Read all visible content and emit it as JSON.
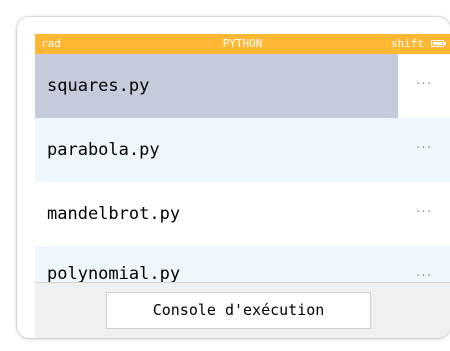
{
  "status_bar": {
    "left": "rad",
    "center": "PYTHON",
    "right": "shift",
    "battery_icon": "battery-icon",
    "battery_level": 1.0,
    "color": "#ffb734"
  },
  "scripts": [
    {
      "name": "squares.py",
      "menu": "···",
      "selected": true
    },
    {
      "name": "parabola.py",
      "menu": "···",
      "selected": false
    },
    {
      "name": "mandelbrot.py",
      "menu": "···",
      "selected": false
    },
    {
      "name": "polynomial.py",
      "menu": "···",
      "selected": false
    }
  ],
  "console_button": "Console d'exécution",
  "colors": {
    "selected_row": "#c6cbdc",
    "alt_row": "#eef6fe",
    "status_bar": "#ffb734"
  }
}
